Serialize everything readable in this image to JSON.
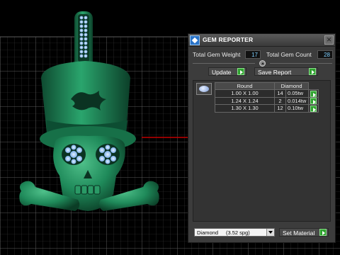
{
  "panel": {
    "title": "GEM REPORTER",
    "close_glyph": "✕",
    "total_weight_label": "Total Gem Weight",
    "total_weight_value": "17",
    "total_count_label": "Total Gem Count",
    "total_count_value": "28",
    "update_label": "Update",
    "save_report_label": "Save Report"
  },
  "gems": {
    "columns": [
      "Round",
      "Diamond"
    ],
    "rows": [
      {
        "size": "1.00 X 1.00",
        "count": "14",
        "weight": "0.05tw"
      },
      {
        "size": "1.24 X 1.24",
        "count": "2",
        "weight": "0.014tw"
      },
      {
        "size": "1.30 X 1.30",
        "count": "12",
        "weight": "0.10tw"
      }
    ]
  },
  "material": {
    "name": "Diamond",
    "sg": "(3.52 spg)",
    "set_label": "Set Material"
  },
  "colors": {
    "model_green": "#1f8a5a",
    "grid": "#5a5a5a",
    "axis_red": "#c00000",
    "accent_blue": "#2a74c8",
    "go_green": "#2fa22f"
  },
  "icons": {
    "app": "gem-reporter-icon",
    "collapse": "collapse-up-icon",
    "go": "play-arrow-icon",
    "dropdown": "chevron-down-icon"
  }
}
